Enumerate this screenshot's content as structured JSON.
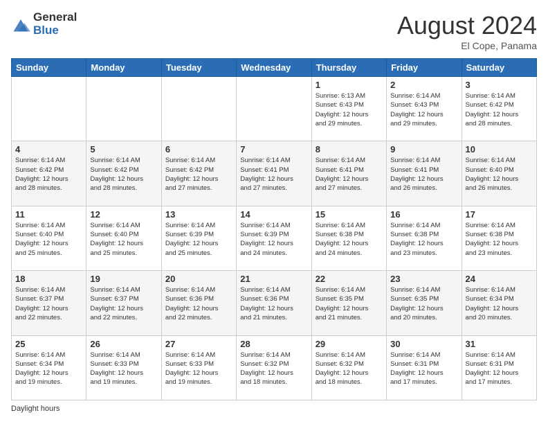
{
  "logo": {
    "general": "General",
    "blue": "Blue"
  },
  "header": {
    "title": "August 2024",
    "location": "El Cope, Panama"
  },
  "days_of_week": [
    "Sunday",
    "Monday",
    "Tuesday",
    "Wednesday",
    "Thursday",
    "Friday",
    "Saturday"
  ],
  "weeks": [
    [
      {
        "day": "",
        "info": ""
      },
      {
        "day": "",
        "info": ""
      },
      {
        "day": "",
        "info": ""
      },
      {
        "day": "",
        "info": ""
      },
      {
        "day": "1",
        "info": "Sunrise: 6:13 AM\nSunset: 6:43 PM\nDaylight: 12 hours\nand 29 minutes."
      },
      {
        "day": "2",
        "info": "Sunrise: 6:14 AM\nSunset: 6:43 PM\nDaylight: 12 hours\nand 29 minutes."
      },
      {
        "day": "3",
        "info": "Sunrise: 6:14 AM\nSunset: 6:42 PM\nDaylight: 12 hours\nand 28 minutes."
      }
    ],
    [
      {
        "day": "4",
        "info": "Sunrise: 6:14 AM\nSunset: 6:42 PM\nDaylight: 12 hours\nand 28 minutes."
      },
      {
        "day": "5",
        "info": "Sunrise: 6:14 AM\nSunset: 6:42 PM\nDaylight: 12 hours\nand 28 minutes."
      },
      {
        "day": "6",
        "info": "Sunrise: 6:14 AM\nSunset: 6:42 PM\nDaylight: 12 hours\nand 27 minutes."
      },
      {
        "day": "7",
        "info": "Sunrise: 6:14 AM\nSunset: 6:41 PM\nDaylight: 12 hours\nand 27 minutes."
      },
      {
        "day": "8",
        "info": "Sunrise: 6:14 AM\nSunset: 6:41 PM\nDaylight: 12 hours\nand 27 minutes."
      },
      {
        "day": "9",
        "info": "Sunrise: 6:14 AM\nSunset: 6:41 PM\nDaylight: 12 hours\nand 26 minutes."
      },
      {
        "day": "10",
        "info": "Sunrise: 6:14 AM\nSunset: 6:40 PM\nDaylight: 12 hours\nand 26 minutes."
      }
    ],
    [
      {
        "day": "11",
        "info": "Sunrise: 6:14 AM\nSunset: 6:40 PM\nDaylight: 12 hours\nand 25 minutes."
      },
      {
        "day": "12",
        "info": "Sunrise: 6:14 AM\nSunset: 6:40 PM\nDaylight: 12 hours\nand 25 minutes."
      },
      {
        "day": "13",
        "info": "Sunrise: 6:14 AM\nSunset: 6:39 PM\nDaylight: 12 hours\nand 25 minutes."
      },
      {
        "day": "14",
        "info": "Sunrise: 6:14 AM\nSunset: 6:39 PM\nDaylight: 12 hours\nand 24 minutes."
      },
      {
        "day": "15",
        "info": "Sunrise: 6:14 AM\nSunset: 6:38 PM\nDaylight: 12 hours\nand 24 minutes."
      },
      {
        "day": "16",
        "info": "Sunrise: 6:14 AM\nSunset: 6:38 PM\nDaylight: 12 hours\nand 23 minutes."
      },
      {
        "day": "17",
        "info": "Sunrise: 6:14 AM\nSunset: 6:38 PM\nDaylight: 12 hours\nand 23 minutes."
      }
    ],
    [
      {
        "day": "18",
        "info": "Sunrise: 6:14 AM\nSunset: 6:37 PM\nDaylight: 12 hours\nand 22 minutes."
      },
      {
        "day": "19",
        "info": "Sunrise: 6:14 AM\nSunset: 6:37 PM\nDaylight: 12 hours\nand 22 minutes."
      },
      {
        "day": "20",
        "info": "Sunrise: 6:14 AM\nSunset: 6:36 PM\nDaylight: 12 hours\nand 22 minutes."
      },
      {
        "day": "21",
        "info": "Sunrise: 6:14 AM\nSunset: 6:36 PM\nDaylight: 12 hours\nand 21 minutes."
      },
      {
        "day": "22",
        "info": "Sunrise: 6:14 AM\nSunset: 6:35 PM\nDaylight: 12 hours\nand 21 minutes."
      },
      {
        "day": "23",
        "info": "Sunrise: 6:14 AM\nSunset: 6:35 PM\nDaylight: 12 hours\nand 20 minutes."
      },
      {
        "day": "24",
        "info": "Sunrise: 6:14 AM\nSunset: 6:34 PM\nDaylight: 12 hours\nand 20 minutes."
      }
    ],
    [
      {
        "day": "25",
        "info": "Sunrise: 6:14 AM\nSunset: 6:34 PM\nDaylight: 12 hours\nand 19 minutes."
      },
      {
        "day": "26",
        "info": "Sunrise: 6:14 AM\nSunset: 6:33 PM\nDaylight: 12 hours\nand 19 minutes."
      },
      {
        "day": "27",
        "info": "Sunrise: 6:14 AM\nSunset: 6:33 PM\nDaylight: 12 hours\nand 19 minutes."
      },
      {
        "day": "28",
        "info": "Sunrise: 6:14 AM\nSunset: 6:32 PM\nDaylight: 12 hours\nand 18 minutes."
      },
      {
        "day": "29",
        "info": "Sunrise: 6:14 AM\nSunset: 6:32 PM\nDaylight: 12 hours\nand 18 minutes."
      },
      {
        "day": "30",
        "info": "Sunrise: 6:14 AM\nSunset: 6:31 PM\nDaylight: 12 hours\nand 17 minutes."
      },
      {
        "day": "31",
        "info": "Sunrise: 6:14 AM\nSunset: 6:31 PM\nDaylight: 12 hours\nand 17 minutes."
      }
    ]
  ],
  "footer": {
    "daylight_label": "Daylight hours"
  }
}
